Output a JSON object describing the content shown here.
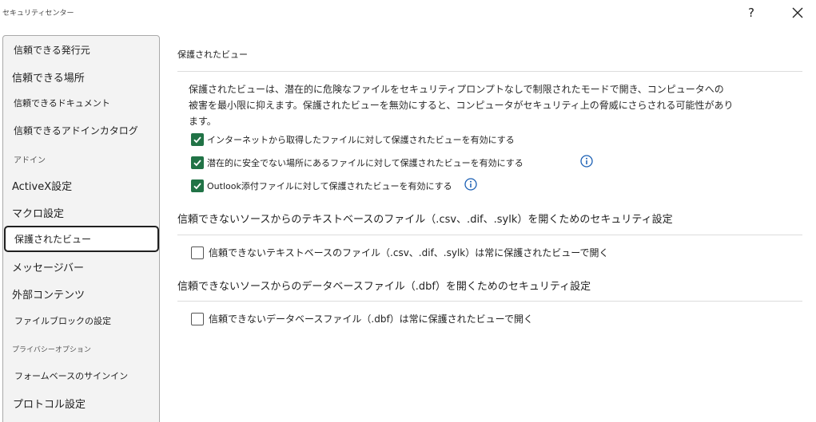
{
  "window": {
    "title": "セキュリティセンター",
    "help_label": "?"
  },
  "sidebar": {
    "items": [
      {
        "label": "信頼できる発行元"
      },
      {
        "label": "信頼できる場所"
      },
      {
        "label": "信頼できるドキュメント"
      },
      {
        "label": "信頼できるアドインカタログ"
      },
      {
        "label": "アドイン"
      },
      {
        "label": "ActiveX設定"
      },
      {
        "label": "マクロ設定"
      },
      {
        "label": "保護されたビュー"
      },
      {
        "label": "メッセージバー"
      },
      {
        "label": "外部コンテンツ"
      },
      {
        "label": "ファイルブロックの設定"
      },
      {
        "label": "プライバシーオプション"
      },
      {
        "label": "フォームベースのサインイン"
      },
      {
        "label": "プロトコル設定"
      }
    ],
    "selected": "保護されたビュー"
  },
  "protected_view": {
    "title": "保護されたビュー",
    "description_lines": [
      "保護されたビューは、潜在的に危険なファイルをセキュリティプロンプトなしで制限されたモードで開き、コンピュータへの",
      "被害を最小限に抑えます。保護されたビューを無効にすると、コンピュータがセキュリティ上の脅威にさらされる可能性があり",
      "ます。"
    ],
    "options": [
      {
        "label": "インターネットから取得したファイルに対して保護されたビューを有効にする",
        "checked": true
      },
      {
        "label": "潜在的に安全でない場所にあるファイルに対して保護されたビューを有効にする",
        "checked": true
      },
      {
        "label": "Outlook添付ファイルに対して保護されたビューを有効にする",
        "checked": true
      }
    ]
  },
  "text_files": {
    "title": "信頼できないソースからのテキストベースのファイル（.csv、.dif、.sylk）を開くためのセキュリティ設定",
    "option": {
      "label": "信頼できないテキストベースのファイル（.csv、.dif、.sylk）は常に保護されたビューで開く",
      "checked": false
    }
  },
  "db_files": {
    "title": "信頼できないソースからのデータベースファイル（.dbf）を開くためのセキュリティ設定",
    "option": {
      "label": "信頼できないデータベースファイル（.dbf）は常に保護されたビューで開く",
      "checked": false
    }
  },
  "colors": {
    "checkbox_checked": "#217346",
    "info_icon": "#1a5fb4"
  }
}
